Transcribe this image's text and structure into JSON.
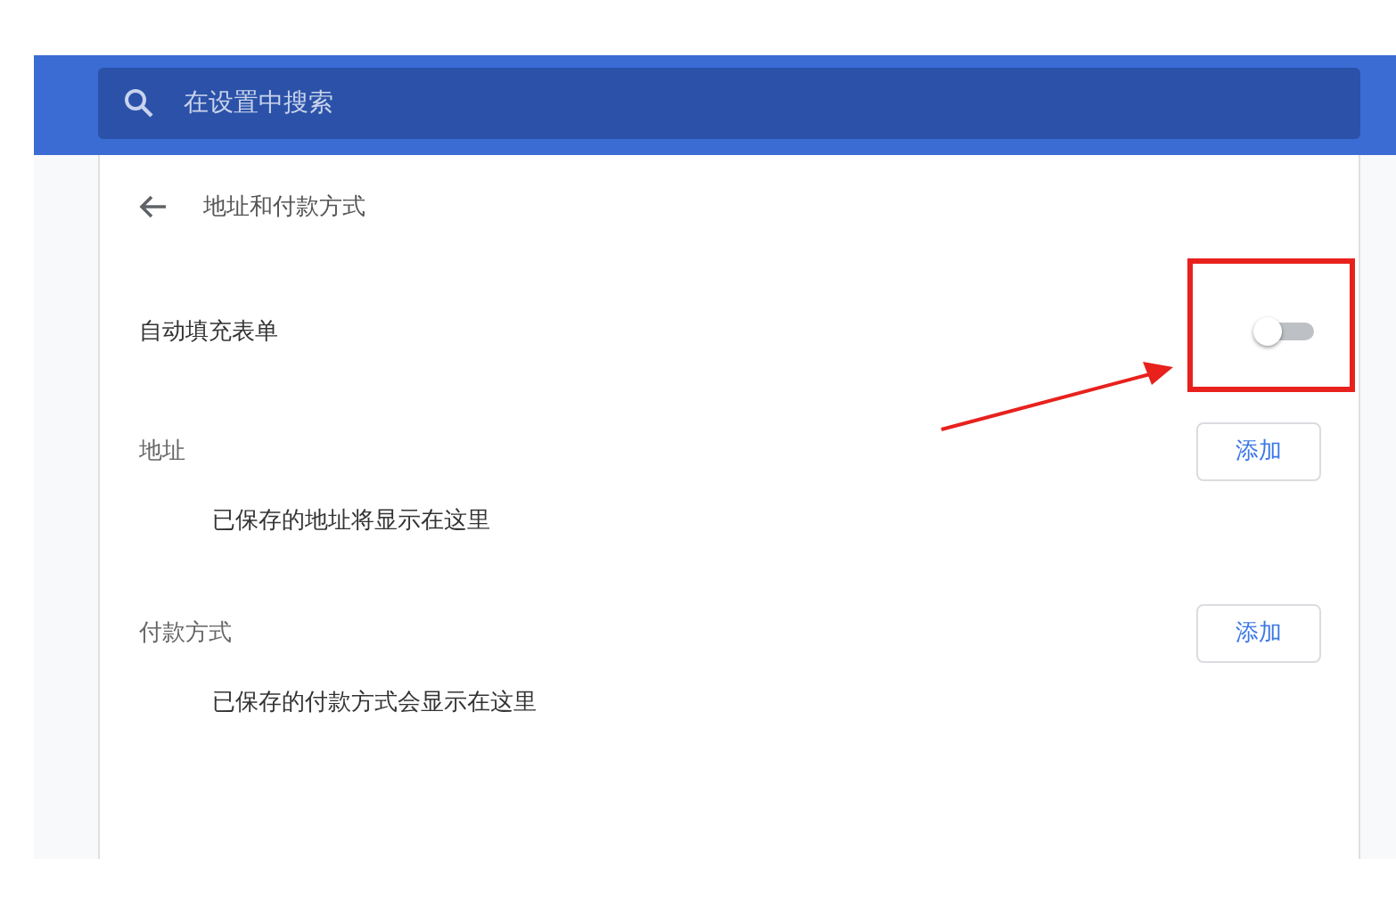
{
  "search": {
    "placeholder": "在设置中搜索"
  },
  "page": {
    "title": "地址和付款方式"
  },
  "autofill": {
    "label": "自动填充表单",
    "on": false
  },
  "sections": [
    {
      "label": "地址",
      "button": "添加",
      "empty_text": "已保存的地址将显示在这里"
    },
    {
      "label": "付款方式",
      "button": "添加",
      "empty_text": "已保存的付款方式会显示在这里"
    }
  ]
}
